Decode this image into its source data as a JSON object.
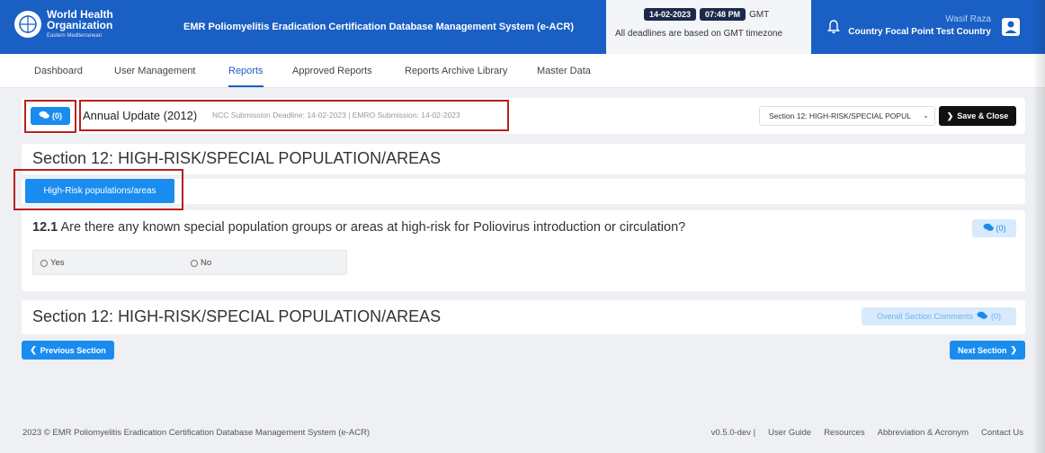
{
  "header": {
    "logo_line1": "World Health",
    "logo_line2": "Organization",
    "logo_line3": "Eastern Mediterranean",
    "system_title": "EMR Poliomyelitis Eradication Certification Database Management System (e-ACR)",
    "date": "14-02-2023",
    "time": "07:48 PM",
    "timezone": "GMT",
    "deadline_note": "All deadlines are based on GMT timezone",
    "user_name": "Wasif Raza",
    "user_role": "Country Focal Point Test Country"
  },
  "nav": {
    "items": [
      "Dashboard",
      "User Management",
      "Reports",
      "Approved Reports",
      "Reports Archive Library",
      "Master Data"
    ],
    "active": "Reports"
  },
  "toolbar": {
    "comments_count": "(0)",
    "report_title": "Annual Update (2012)",
    "report_meta": "NCC Submission Deadline: 14-02-2023 | EMRO Submission: 14-02-2023",
    "section_select": "Section 12: HIGH-RISK/SPECIAL POPUL",
    "save_label": "Save & Close"
  },
  "section": {
    "heading": "Section 12: HIGH-RISK/SPECIAL POPULATION/AREAS",
    "tab_label": "High-Risk populations/areas",
    "question_number": "12.1",
    "question_text": "Are there any known special population groups or areas at high-risk for Poliovirus introduction or circulation?",
    "question_comments": "(0)",
    "options": [
      "Yes",
      "No"
    ],
    "footer_heading": "Section 12: HIGH-RISK/SPECIAL POPULATION/AREAS",
    "overall_comments_label": "Overall Section Comments",
    "overall_comments_count": "(0)"
  },
  "pager": {
    "prev_label": "Previous Section",
    "next_label": "Next Section"
  },
  "footer": {
    "copyright": "2023 ©  EMR Poliomyelitis Eradication Certification Database Management System (e-ACR)",
    "version": "v0.5.0-dev",
    "links": [
      "User Guide",
      "Resources",
      "Abbreviation & Acronym",
      "Contact Us"
    ]
  },
  "colors": {
    "brand_blue": "#1a5fc4",
    "button_blue": "#1a8cf0",
    "highlight_red": "#b82020",
    "dark_button": "#111111"
  }
}
